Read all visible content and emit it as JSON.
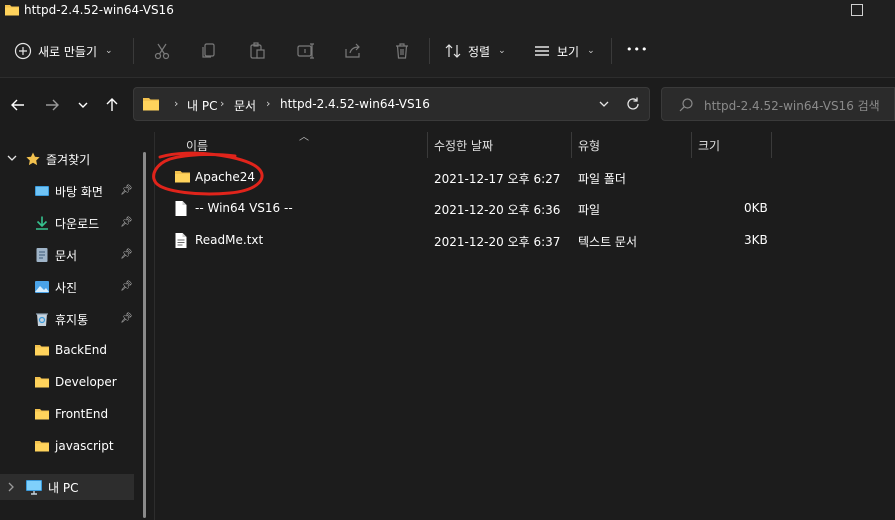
{
  "window": {
    "title": "httpd-2.4.52-win64-VS16"
  },
  "toolbar": {
    "new_label": "새로 만들기",
    "sort_label": "정렬",
    "view_label": "보기",
    "more_label": "•••"
  },
  "address": {
    "crumbs": [
      "내 PC",
      "문서",
      "httpd-2.4.52-win64-VS16"
    ]
  },
  "search": {
    "placeholder": "httpd-2.4.52-win64-VS16 검색"
  },
  "sidebar": {
    "quick_access": "즐겨찾기",
    "items": [
      {
        "label": "바탕 화면",
        "icon": "desktop-icon",
        "pinned": true
      },
      {
        "label": "다운로드",
        "icon": "download-icon",
        "pinned": true
      },
      {
        "label": "문서",
        "icon": "document-icon",
        "pinned": true
      },
      {
        "label": "사진",
        "icon": "pictures-icon",
        "pinned": true
      },
      {
        "label": "휴지통",
        "icon": "recycle-bin-icon",
        "pinned": true
      },
      {
        "label": "BackEnd",
        "icon": "folder-icon",
        "pinned": false
      },
      {
        "label": "Developer",
        "icon": "folder-icon",
        "pinned": false
      },
      {
        "label": "FrontEnd",
        "icon": "folder-icon",
        "pinned": false
      },
      {
        "label": "javascript",
        "icon": "folder-icon",
        "pinned": false
      }
    ],
    "this_pc": "내 PC"
  },
  "columns": {
    "name": "이름",
    "modified": "수정한 날짜",
    "type": "유형",
    "size": "크기"
  },
  "files": [
    {
      "name": "Apache24",
      "modified": "2021-12-17 오후 6:27",
      "type": "파일 폴더",
      "size": "",
      "icon": "folder-icon"
    },
    {
      "name": "-- Win64 VS16  --",
      "modified": "2021-12-20 오후 6:36",
      "type": "파일",
      "size": "0KB",
      "icon": "file-icon"
    },
    {
      "name": "ReadMe.txt",
      "modified": "2021-12-20 오후 6:37",
      "type": "텍스트 문서",
      "size": "3KB",
      "icon": "text-file-icon"
    }
  ],
  "colors": {
    "background": "#1c1c1c",
    "folder": "#f2c14e",
    "annotation": "#e0241b",
    "accent": "#4cc2ff"
  }
}
